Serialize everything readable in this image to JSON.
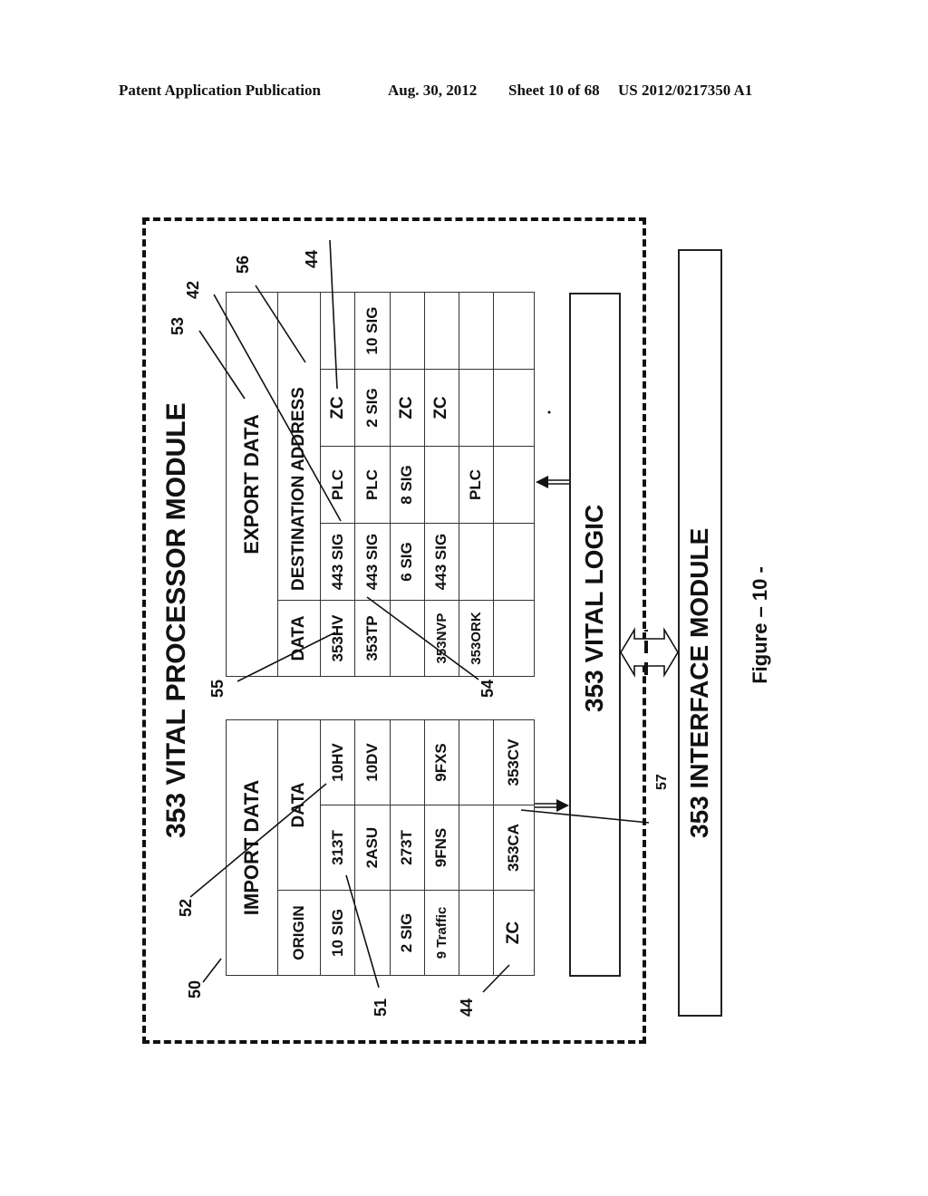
{
  "header": {
    "publication": "Patent Application Publication",
    "date": "Aug. 30, 2012",
    "sheet": "Sheet 10 of 68",
    "number": "US 2012/0217350 A1"
  },
  "diagram": {
    "processor_module_title": "353 VITAL PROCESSOR MODULE",
    "vital_logic_label": "353 VITAL LOGIC",
    "interface_module_label": "353 INTERFACE MODULE",
    "figure_caption": "Figure – 10 -",
    "import_table": {
      "title": "IMPORT DATA",
      "headers": [
        "ORIGIN",
        "DATA"
      ],
      "rows": [
        [
          "10 SIG",
          "313T",
          "10HV"
        ],
        [
          "",
          "2ASU",
          "10DV"
        ],
        [
          "2 SIG",
          "273T",
          ""
        ],
        [
          "9 Traffic",
          "9FNS",
          "9FXS"
        ],
        [
          "",
          "",
          ""
        ],
        [
          "ZC",
          "353CA",
          "353CV"
        ]
      ]
    },
    "export_table": {
      "title": "EXPORT DATA",
      "headers": [
        "DATA",
        "DESTINATION ADDRESS"
      ],
      "rows": [
        [
          "353HV",
          "443 SIG",
          "PLC",
          "ZC",
          ""
        ],
        [
          "353TP",
          "443 SIG",
          "PLC",
          "2 SIG",
          "10 SIG"
        ],
        [
          "",
          "6 SIG",
          "8 SIG",
          "ZC",
          ""
        ],
        [
          "353NVP",
          "443 SIG",
          "",
          "ZC",
          ""
        ],
        [
          "353ORK",
          "",
          "PLC",
          "",
          ""
        ],
        [
          "",
          "",
          "",
          "",
          ""
        ]
      ]
    },
    "reference_numerals": {
      "r50": "50",
      "r51": "51",
      "r52": "52",
      "r44a": "44",
      "r44b": "44",
      "r53": "53",
      "r54": "54",
      "r55": "55",
      "r56": "56",
      "r42": "42",
      "r57": "57"
    }
  }
}
